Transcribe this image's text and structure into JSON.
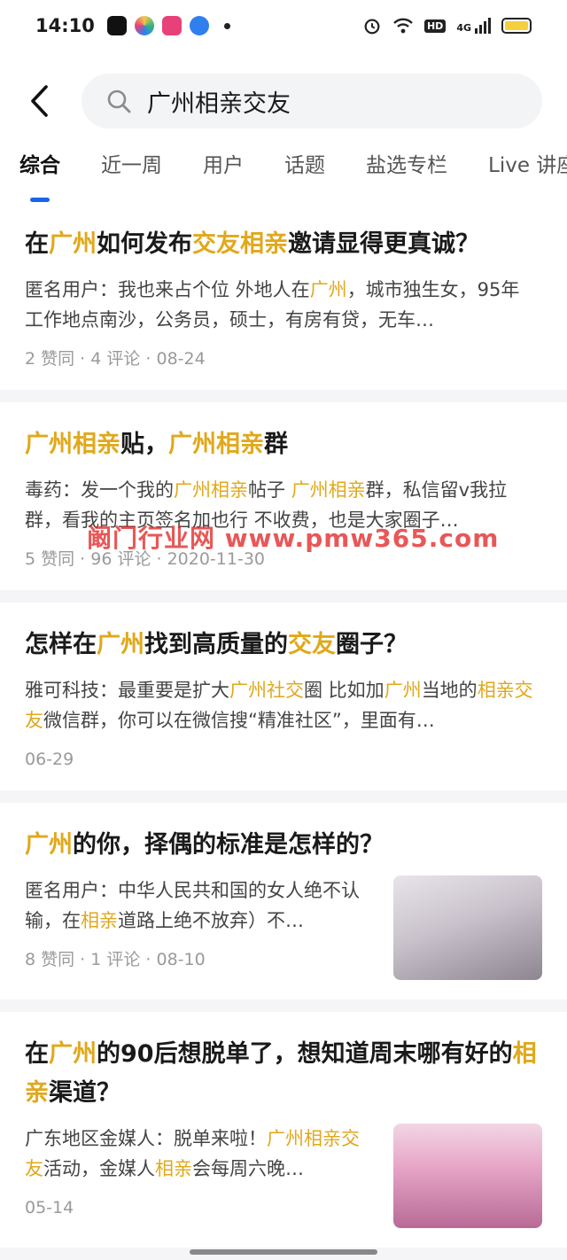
{
  "status_bar": {
    "time": "14:10",
    "apps": [
      {
        "icon": "tiktok-app-icon",
        "color": "#111111"
      },
      {
        "icon": "colorful-app-icon",
        "color": "#36b37e"
      },
      {
        "icon": "video-app-icon",
        "color": "#e8417a"
      },
      {
        "icon": "blue-app-icon",
        "color": "#2f80ed"
      }
    ],
    "icons": [
      "alarm-icon",
      "wifi-icon",
      "hd-icon",
      "signal-icon",
      "battery-icon"
    ],
    "hd_label": "HD",
    "network_label": "4G"
  },
  "search": {
    "query": "广州相亲交友"
  },
  "tabs": [
    {
      "label": "综合",
      "active": true
    },
    {
      "label": "近一周",
      "active": false
    },
    {
      "label": "用户",
      "active": false
    },
    {
      "label": "话题",
      "active": false
    },
    {
      "label": "盐选专栏",
      "active": false
    },
    {
      "label": "Live 讲座",
      "active": false
    }
  ],
  "results": [
    {
      "title": [
        {
          "t": "在",
          "h": false
        },
        {
          "t": "广州",
          "h": true
        },
        {
          "t": "如何发布",
          "h": false
        },
        {
          "t": "交友相亲",
          "h": true
        },
        {
          "t": "邀请显得更真诚？",
          "h": false
        }
      ],
      "snippet": [
        {
          "t": "匿名用户：我也来占个位 外地人在",
          "h": false
        },
        {
          "t": "广州",
          "h": true
        },
        {
          "t": "，城市独生女，95年 工作地点南沙，公务员，硕士，有房有贷，无车…",
          "h": false
        }
      ],
      "meta": "2 赞同 · 4 评论 · 08-24",
      "thumb": false
    },
    {
      "title": [
        {
          "t": "广州相亲",
          "h": true
        },
        {
          "t": "贴，",
          "h": false
        },
        {
          "t": "广州相亲",
          "h": true
        },
        {
          "t": "群",
          "h": false
        }
      ],
      "snippet": [
        {
          "t": "毒药：发一个我的",
          "h": false
        },
        {
          "t": "广州相亲",
          "h": true
        },
        {
          "t": "帖子 ",
          "h": false
        },
        {
          "t": "广州相亲",
          "h": true
        },
        {
          "t": "群，私信留v我拉群，看我的主页签名加也行 不收费，也是大家圈子…",
          "h": false
        }
      ],
      "meta": "5 赞同 · 96 评论 · 2020-11-30",
      "thumb": false
    },
    {
      "title": [
        {
          "t": "怎样在",
          "h": false
        },
        {
          "t": "广州",
          "h": true
        },
        {
          "t": "找到高质量的",
          "h": false
        },
        {
          "t": "交友",
          "h": true
        },
        {
          "t": "圈子？",
          "h": false
        }
      ],
      "snippet": [
        {
          "t": "雅可科技：最重要是扩大",
          "h": false
        },
        {
          "t": "广州社交",
          "h": true
        },
        {
          "t": "圈 比如加",
          "h": false
        },
        {
          "t": "广州",
          "h": true
        },
        {
          "t": "当地的",
          "h": false
        },
        {
          "t": "相亲交友",
          "h": true
        },
        {
          "t": "微信群，你可以在微信搜“精准社区”，里面有…",
          "h": false
        }
      ],
      "meta": "06-29",
      "thumb": false
    },
    {
      "title": [
        {
          "t": "广州",
          "h": true
        },
        {
          "t": "的你，择偶的标准是怎样的？",
          "h": false
        }
      ],
      "snippet": [
        {
          "t": "匿名用户：中华人民共和国的女人绝不认输，在",
          "h": false
        },
        {
          "t": "相亲",
          "h": true
        },
        {
          "t": "道路上绝不放弃）不…",
          "h": false
        }
      ],
      "meta": "8 赞同 · 1 评论 · 08-10",
      "thumb": true,
      "thumb_style": "thumb1"
    },
    {
      "title": [
        {
          "t": "在",
          "h": false
        },
        {
          "t": "广州",
          "h": true
        },
        {
          "t": "的90后想脱单了，想知道周末哪有好的",
          "h": false
        },
        {
          "t": "相亲",
          "h": true
        },
        {
          "t": "渠道？",
          "h": false
        }
      ],
      "snippet": [
        {
          "t": "广东地区金媒人：脱单来啦！",
          "h": false
        },
        {
          "t": "广州相亲交友",
          "h": true
        },
        {
          "t": "活动，金媒人",
          "h": false
        },
        {
          "t": "相亲",
          "h": true
        },
        {
          "t": "会每周六晚…",
          "h": false
        }
      ],
      "meta": "05-14",
      "thumb": true,
      "thumb_style": "thumb2"
    }
  ],
  "watermark": "阚门行业网 www.pmw365.com",
  "colors": {
    "highlight": "#e0a81b",
    "tab_indicator": "#1766e8",
    "meta_text": "#9a9a9a"
  }
}
